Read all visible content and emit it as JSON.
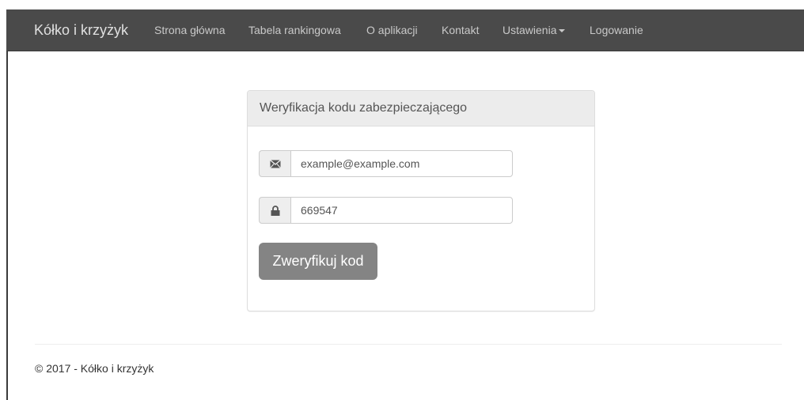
{
  "navbar": {
    "brand": "Kółko i krzyżyk",
    "items": [
      {
        "label": "Strona główna"
      },
      {
        "label": "Tabela rankingowa"
      },
      {
        "label": "O aplikacji"
      },
      {
        "label": "Kontakt"
      },
      {
        "label": "Ustawienia"
      },
      {
        "label": "Logowanie"
      }
    ],
    "background": "#4a4a4a"
  },
  "panel": {
    "title": "Weryfikacja kodu zabezpieczającego",
    "email": {
      "value": "example@example.com",
      "icon": "envelope-icon"
    },
    "code": {
      "value": "669547",
      "icon": "lock-icon"
    },
    "submit_label": "Zweryfikuj kod",
    "button_color": "#848484"
  },
  "footer": {
    "text": "© 2017 - Kółko i krzyżyk"
  }
}
